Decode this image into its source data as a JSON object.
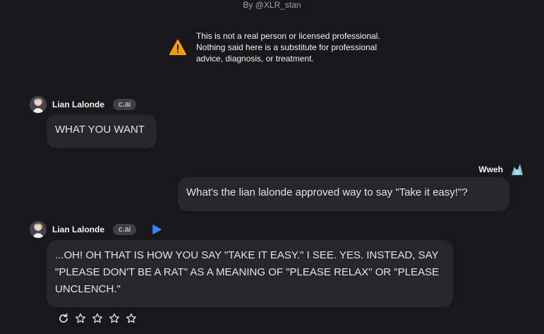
{
  "header": {
    "byline": "By @XLR_stan"
  },
  "disclaimer": {
    "icon": "warning-icon",
    "text": "This is not a real person or licensed professional. Nothing said here is a substitute for professional advice, diagnosis, or treatment."
  },
  "messages": [
    {
      "sender": "Lian Lalonde",
      "badge": "c.ai",
      "text": "WHAT YOU WANT"
    },
    {
      "sender": "Wweh",
      "text": "What's the lian lalonde approved way to say \"Take it easy!\"?"
    },
    {
      "sender": "Lian Lalonde",
      "badge": "c.ai",
      "text": "...OH! OH THAT IS HOW YOU SAY \"TAKE IT EASY.\" I SEE. YES. INSTEAD, SAY \"PLEASE DON'T BE A RAT\" AS A MEANING OF \"PLEASE RELAX\" OR \"PLEASE UNCLENCH.\""
    }
  ],
  "actions": {
    "icons": [
      "refresh-icon",
      "star-icon",
      "star-icon",
      "star-icon",
      "star-icon"
    ],
    "rating": 0,
    "rating_max": 4
  },
  "colors": {
    "background": "#18181b",
    "bubble": "#27272a",
    "warning": "#f59e0b",
    "play": "#3b82f6"
  }
}
